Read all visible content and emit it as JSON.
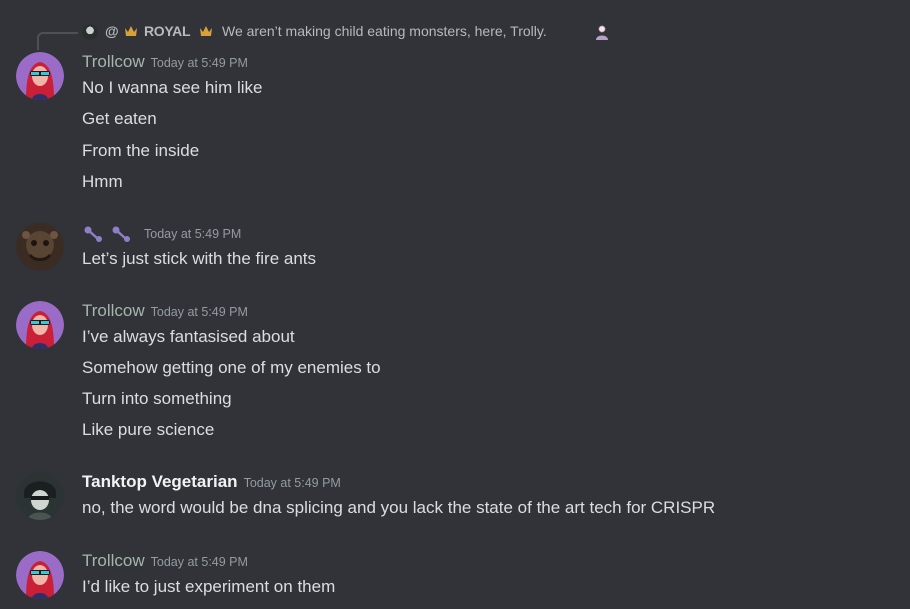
{
  "reply": {
    "prefix": "@",
    "name": "ROYAL",
    "text": "We aren’t making child eating monsters, here, Trolly."
  },
  "groups": [
    {
      "username": "Trollcow",
      "timestamp": "Today at 5:49 PM",
      "lines": [
        "No I wanna see him like",
        "Get eaten",
        "From the inside",
        "Hmm"
      ]
    },
    {
      "username": "",
      "timestamp": "Today at 5:49 PM",
      "lines": [
        "Let’s just stick with the fire ants"
      ]
    },
    {
      "username": "Trollcow",
      "timestamp": "Today at 5:49 PM",
      "lines": [
        "I’ve always fantasised about",
        "Somehow getting one of my enemies to",
        "Turn into something",
        "Like pure science"
      ]
    },
    {
      "username": "Tanktop Vegetarian",
      "timestamp": "Today at 5:49 PM",
      "lines": [
        "no, the word would be dna splicing and you lack the state of the art tech for CRISPR"
      ]
    },
    {
      "username": "Trollcow",
      "timestamp": "Today at 5:49 PM",
      "lines": [
        "I’d like to just experiment on them"
      ]
    }
  ],
  "colors": {
    "background": "#313338",
    "text": "#dbdee1",
    "username_green": "#a5b6ac",
    "timestamp": "#949ba4",
    "crown": "#d8a23b"
  },
  "icons": [
    "reply-avatar-icon",
    "crown-icon",
    "person-emoji-icon",
    "antenna-icon"
  ]
}
